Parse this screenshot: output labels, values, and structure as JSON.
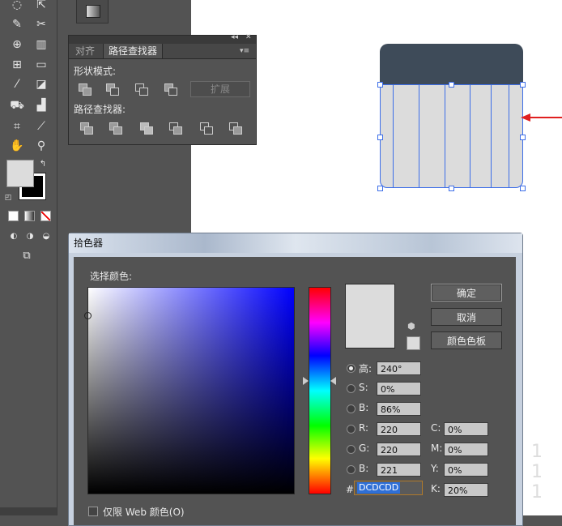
{
  "pathfinder_panel": {
    "tabs": [
      "对齐",
      "路径查找器"
    ],
    "shape_modes_label": "形状模式:",
    "expand_label": "扩展",
    "pathfinders_label": "路径查找器:",
    "top_icons": [
      "◂◂",
      "✕"
    ],
    "menu_icon": "▾≡"
  },
  "color_picker": {
    "title": "拾色器",
    "select_color_label": "选择颜色:",
    "buttons": {
      "ok": "确定",
      "cancel": "取消",
      "swatches": "颜色色板"
    },
    "fields": {
      "H": {
        "label": "高:",
        "value": "240°"
      },
      "S": {
        "label": "S:",
        "value": "0%"
      },
      "B": {
        "label": "B:",
        "value": "86%"
      },
      "R": {
        "label": "R:",
        "value": "220"
      },
      "G": {
        "label": "G:",
        "value": "220"
      },
      "Bl": {
        "label": "B:",
        "value": "221"
      },
      "C": {
        "label": "C:",
        "value": "0%"
      },
      "M": {
        "label": "M:",
        "value": "0%"
      },
      "Y": {
        "label": "Y:",
        "value": "0%"
      },
      "K": {
        "label": "K:",
        "value": "20%"
      }
    },
    "hex_prefix": "#",
    "hex_value": "DCDCDD",
    "web_only_label": "仅限 Web 颜色(O)",
    "current_color": "#dcdcdc"
  },
  "tools": [
    "lasso-icon",
    "free-transform-icon",
    "eraser-icon",
    "warp-icon",
    "shape-builder-icon",
    "gradient-icon",
    "eyedropper-icon",
    "blend-icon",
    "symbol-sprayer-icon",
    "column-graph-icon",
    "artboard-icon",
    "slice-icon",
    "hand-icon",
    "zoom-icon"
  ],
  "colors": {
    "jar_lid": "#3e4b59",
    "jar_body": "#dcdcdc",
    "selection": "#3d6ee8",
    "arrow": "#e02020"
  },
  "canvas_marks": "1 1 1"
}
